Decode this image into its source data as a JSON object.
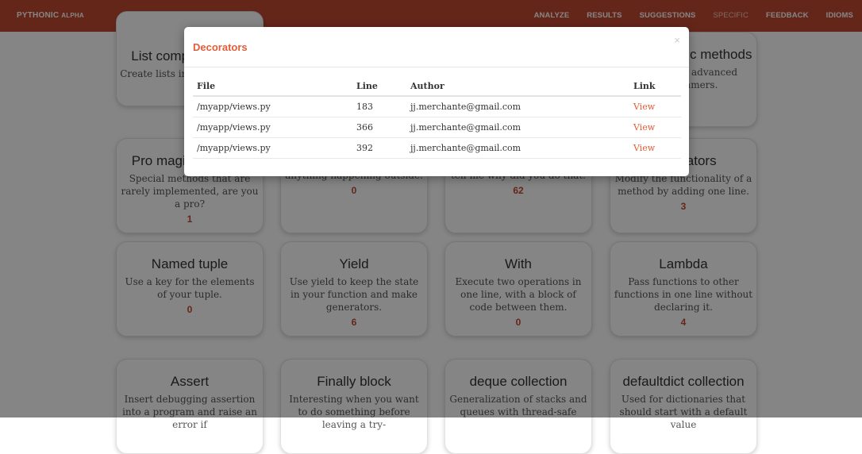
{
  "navbar": {
    "brand": "PYTHONIC",
    "brand_sub": "ALPHA",
    "items": [
      {
        "label": "ANALYZE"
      },
      {
        "label": "RESULTS"
      },
      {
        "label": "SUGGESTIONS"
      },
      {
        "label": "SPECIFIC"
      },
      {
        "label": "FEEDBACK"
      },
      {
        "label": "IDIOMS"
      }
    ]
  },
  "cards": [
    {
      "title": "List comprehension",
      "description": "Create lists in a concise way.",
      "count": ""
    },
    {
      "title": "Private magic methods",
      "description": "Methods for advanced programmers.",
      "count": ""
    },
    {
      "title": "Pro magic methods",
      "description": "Special methods that are rarely implemented, are you a pro?",
      "count": "1"
    },
    {
      "title": "",
      "description": "Protect your function from anything happening outside.",
      "count": "0"
    },
    {
      "title": "",
      "description": "Why? Come in a year and tell me why did you do that.",
      "count": "62"
    },
    {
      "title": "Decorators",
      "description": "Modify the functionality of a method by adding one line.",
      "count": "3"
    },
    {
      "title": "Named tuple",
      "description": "Use a key for the elements of your tuple.",
      "count": "0"
    },
    {
      "title": "Yield",
      "description": "Use yield to keep the state in your function and make generators.",
      "count": "6"
    },
    {
      "title": "With",
      "description": "Execute two operations in one line, with a block of code between them.",
      "count": "0"
    },
    {
      "title": "Lambda",
      "description": "Pass functions to other functions in one line without declaring it.",
      "count": "4"
    },
    {
      "title": "Assert",
      "description": "Insert debugging assertion into a program and raise an error if",
      "count": ""
    },
    {
      "title": "Finally block",
      "description": "Interesting when you want to do something before leaving a try-",
      "count": ""
    },
    {
      "title": "deque collection",
      "description": "Generalization of stacks and queues with thread-safe",
      "count": ""
    },
    {
      "title": "defaultdict collection",
      "description": "Used for dictionaries that should start with a default value",
      "count": ""
    }
  ],
  "modal": {
    "title": "Decorators",
    "close": "×",
    "columns": {
      "file": "File",
      "line": "Line",
      "author": "Author",
      "link": "Link"
    },
    "rows": [
      {
        "file": "/myapp/views.py",
        "line": "183",
        "author": "jj.merchante@gmail.com",
        "link": "View"
      },
      {
        "file": "/myapp/views.py",
        "line": "366",
        "author": "jj.merchante@gmail.com",
        "link": "View"
      },
      {
        "file": "/myapp/views.py",
        "line": "392",
        "author": "jj.merchante@gmail.com",
        "link": "View"
      }
    ]
  },
  "colors": {
    "navbar": "#c24a33",
    "accent": "#e45c3a",
    "overlay": "rgba(0,0,0,0.48)"
  }
}
